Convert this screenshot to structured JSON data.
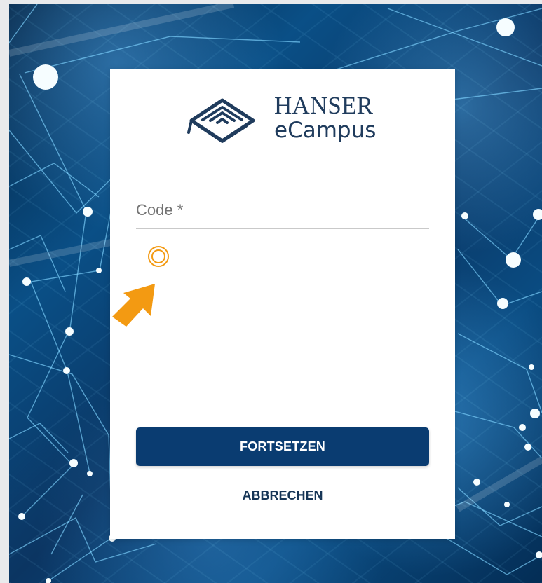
{
  "brand": {
    "title_line1": "HANSER",
    "title_line2": "eCampus"
  },
  "form": {
    "code_placeholder": "Code *"
  },
  "actions": {
    "continue_label": "FORTSETZEN",
    "cancel_label": "ABBRECHEN"
  },
  "colors": {
    "primary": "#0a3c71",
    "brand_text": "#203c5d",
    "cursor_orange": "#f39a12"
  },
  "icons": {
    "logo": "graduation-cap-icon",
    "pointer": "pointer-arrow-icon",
    "tap_ring": "tap-ring-icon"
  }
}
